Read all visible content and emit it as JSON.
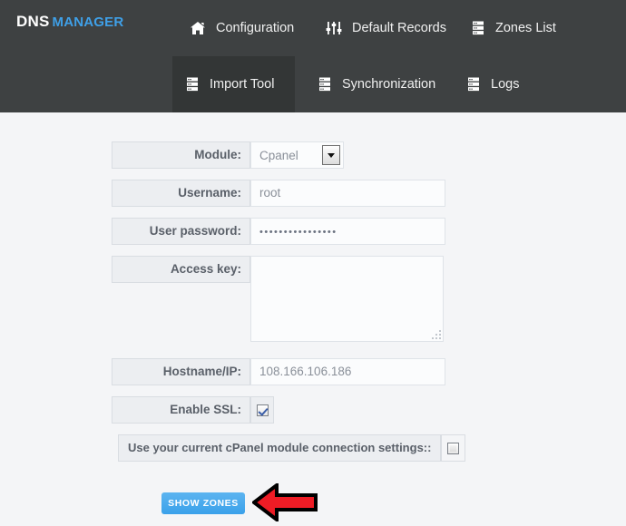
{
  "brand": {
    "primary": "DNS",
    "secondary": "MANAGER",
    "accent_color": "#3fa0e8"
  },
  "header": {
    "background_color": "#3e4142",
    "active_tab_color": "#333636",
    "primary_nav": [
      {
        "label": "Configuration",
        "icon": "home-icon"
      },
      {
        "label": "Default Records",
        "icon": "sliders-icon"
      },
      {
        "label": "Zones List",
        "icon": "server-icon"
      }
    ],
    "secondary_nav": [
      {
        "label": "Import Tool",
        "icon": "server-icon",
        "active": true
      },
      {
        "label": "Synchronization",
        "icon": "server-icon",
        "active": false
      },
      {
        "label": "Logs",
        "icon": "server-icon",
        "active": false
      }
    ]
  },
  "form": {
    "module": {
      "label": "Module:",
      "value": "Cpanel",
      "options": [
        "Cpanel"
      ]
    },
    "username": {
      "label": "Username:",
      "value": "root"
    },
    "password": {
      "label": "User password:",
      "value": "••••••••••••••••"
    },
    "access_key": {
      "label": "Access key:",
      "value": ""
    },
    "hostname": {
      "label": "Hostname/IP:",
      "value": "108.166.106.186"
    },
    "enable_ssl": {
      "label": "Enable SSL:",
      "checked": true
    },
    "use_current_settings": {
      "label": "Use your current cPanel module connection settings::",
      "checked": false
    },
    "submit": {
      "label": "SHOW ZONES",
      "color": "#3aa1ea"
    }
  },
  "annotation": {
    "type": "arrow",
    "direction": "left",
    "color": "#ee1c25"
  }
}
